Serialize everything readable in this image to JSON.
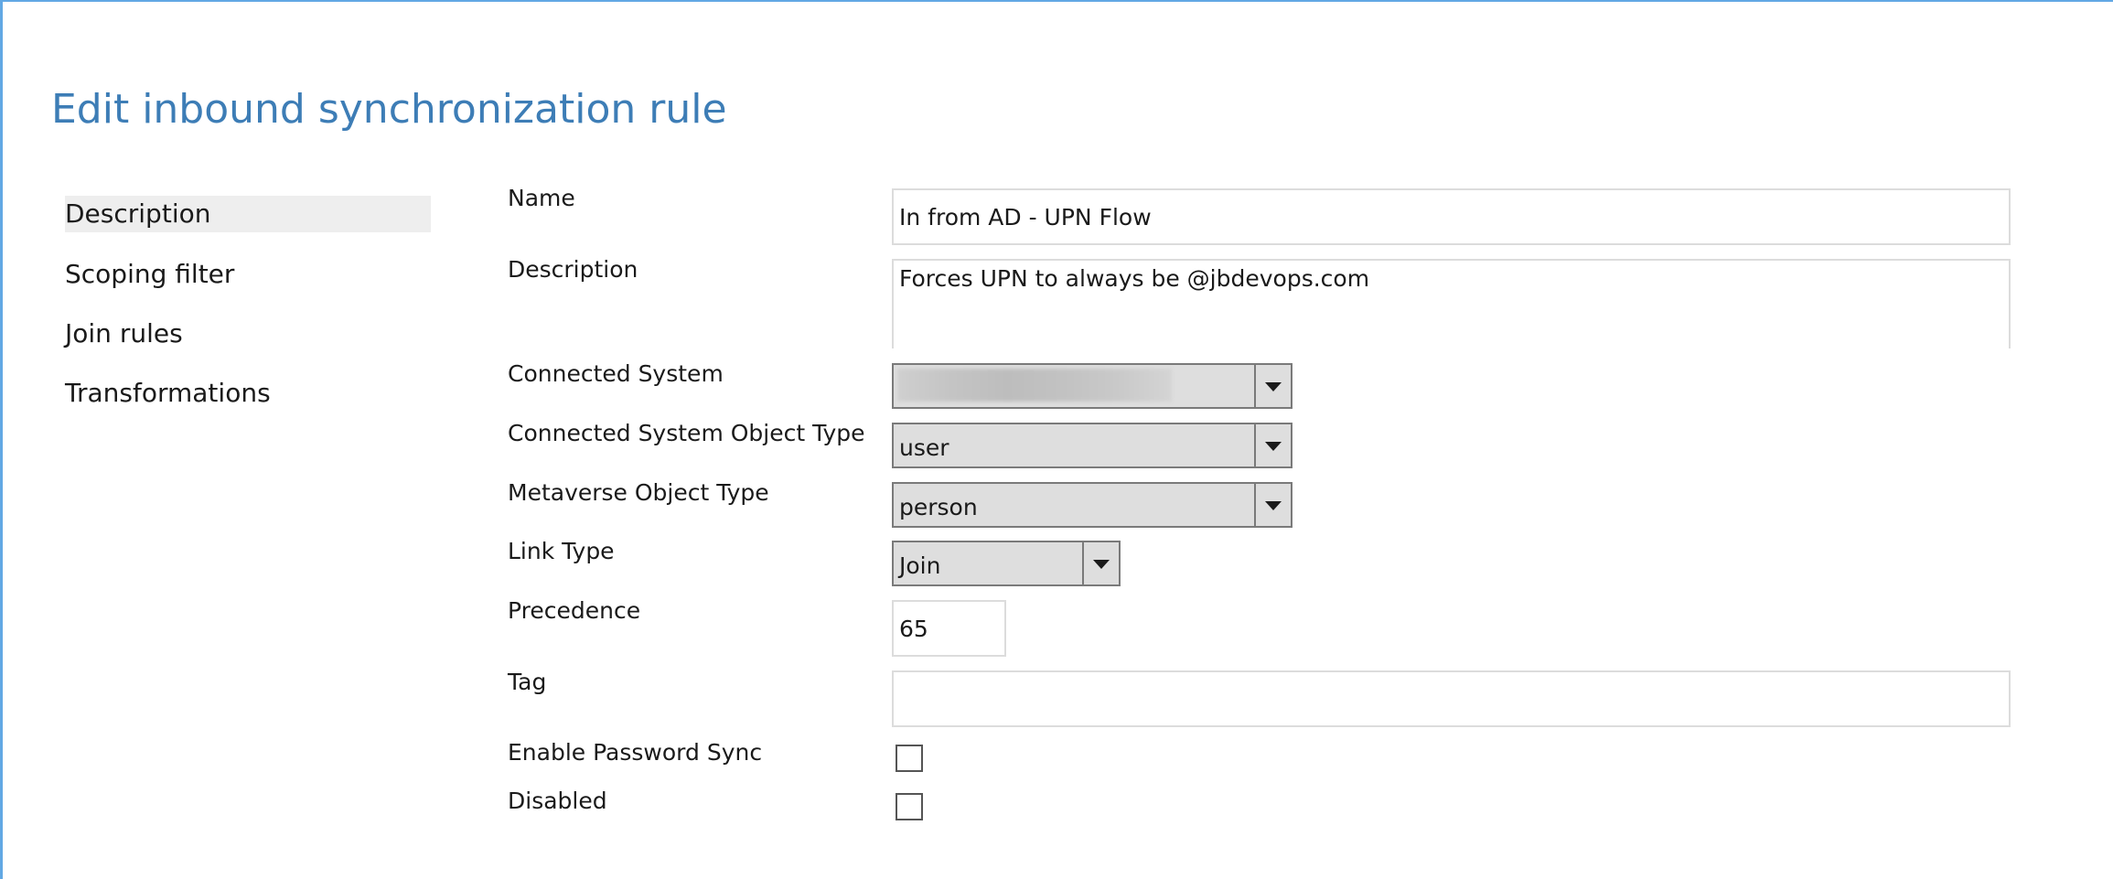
{
  "page": {
    "title": "Edit inbound synchronization rule"
  },
  "nav": {
    "items": [
      {
        "label": "Description",
        "selected": true
      },
      {
        "label": "Scoping filter",
        "selected": false
      },
      {
        "label": "Join rules",
        "selected": false
      },
      {
        "label": "Transformations",
        "selected": false
      }
    ]
  },
  "form": {
    "name": {
      "label": "Name",
      "value": "In from AD - UPN Flow"
    },
    "description": {
      "label": "Description",
      "value": "Forces UPN to always be @jbdevops.com"
    },
    "connected_system": {
      "label": "Connected System",
      "value": ""
    },
    "connected_system_object_type": {
      "label": "Connected System Object Type",
      "value": "user"
    },
    "metaverse_object_type": {
      "label": "Metaverse Object Type",
      "value": "person"
    },
    "link_type": {
      "label": "Link Type",
      "value": "Join"
    },
    "precedence": {
      "label": "Precedence",
      "value": "65"
    },
    "tag": {
      "label": "Tag",
      "value": ""
    },
    "enable_password_sync": {
      "label": "Enable Password Sync",
      "checked": false
    },
    "disabled": {
      "label": "Disabled",
      "checked": false
    }
  },
  "colors": {
    "title": "#3d7db6",
    "window_border": "#62a8e4",
    "nav_selected_bg": "#eeeeee",
    "select_bg": "#dedede"
  }
}
